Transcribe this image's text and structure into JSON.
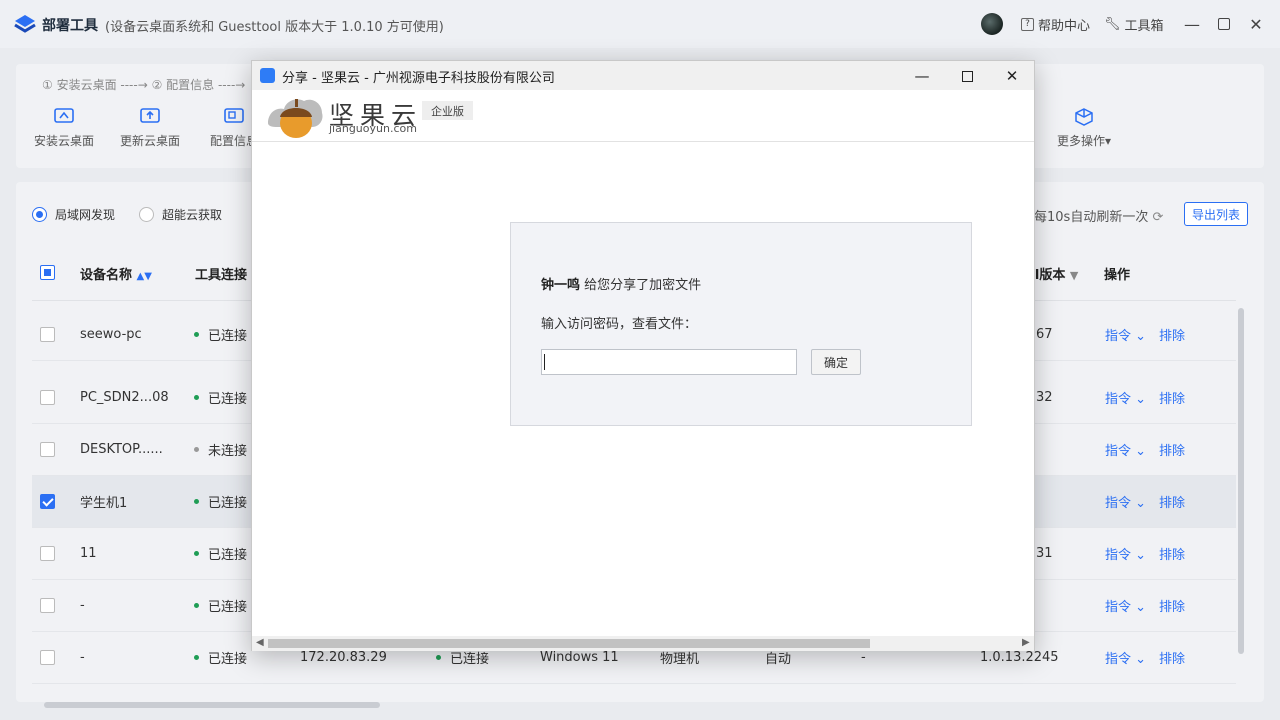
{
  "app": {
    "title": "部署工具",
    "subtitle": "(设备云桌面系统和 Guesttool 版本大于 1.0.10 方可使用)",
    "help": "帮助中心",
    "toolbox": "工具箱"
  },
  "steps": "① 安装云桌面 ----→ ② 配置信息 ----→",
  "toolbar": {
    "install": "安装云桌面",
    "update": "更新云桌面",
    "config": "配置信息",
    "more": "更多操作▾"
  },
  "discover": {
    "lan": "局域网发现",
    "cloud": "超能云获取",
    "refresh": "每10s自动刷新一次",
    "export": "导出列表"
  },
  "table": {
    "headers": {
      "name": "设备名称",
      "tool_conn": "工具连接",
      "version": "ol版本",
      "ops": "操作"
    },
    "rows": [
      {
        "name": "seewo-pc",
        "status": "已连接",
        "ver": "67",
        "cmd": "指令 ⌄",
        "del": "排除"
      },
      {
        "name": "PC_SDN2...08",
        "status": "已连接",
        "ver": "32",
        "cmd": "指令 ⌄",
        "del": "排除"
      },
      {
        "name": "DESKTOP......",
        "status": "未连接",
        "ver": "",
        "cmd": "指令 ⌄",
        "del": "排除"
      },
      {
        "name": "学生机1",
        "status": "已连接",
        "ver": "",
        "cmd": "指令 ⌄",
        "del": "排除"
      },
      {
        "name": "11",
        "status": "已连接",
        "ver": "31",
        "cmd": "指令 ⌄",
        "del": "排除"
      },
      {
        "name": "-",
        "status": "已连接",
        "ver": "",
        "cmd": "指令 ⌄",
        "del": "排除"
      },
      {
        "name": "-",
        "status": "已连接",
        "ip": "172.20.83.29",
        "status2": "已连接",
        "os": "Windows 11",
        "type": "物理机",
        "mode": "自动",
        "dash": "-",
        "ver": "1.0.13.2245",
        "cmd": "指令 ⌄",
        "del": "排除"
      }
    ]
  },
  "dialog": {
    "title": "分享 - 坚果云 - 广州视源电子科技股份有限公司",
    "brand": "坚果云",
    "brand_url": "jianguoyun.com",
    "edition": "企业版",
    "sharer": "钟一鸣",
    "share_msg": " 给您分享了加密文件",
    "prompt": "输入访问密码，查看文件：",
    "password_value": "",
    "ok": "确定"
  },
  "colors": {
    "accent": "#2b6ff3",
    "connected": "#1f9d55"
  }
}
